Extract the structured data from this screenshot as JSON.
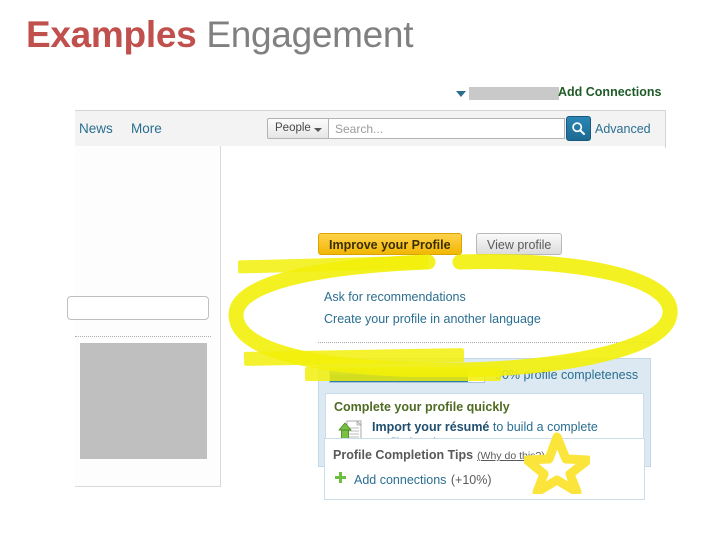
{
  "slide": {
    "title_strong": "Examples",
    "title_normal": " Engagement"
  },
  "screenshot": {
    "topbar": {
      "name_caret_icon": "caret-down-icon",
      "redacted_name": "",
      "add_connections_label": "Add Connections"
    },
    "navbar": {
      "links": [
        {
          "label": "News"
        },
        {
          "label": "More"
        }
      ],
      "search_scope_label": "People",
      "search_scope_caret_icon": "caret-down-icon",
      "search_placeholder": "Search...",
      "search_value": "",
      "search_button_icon": "search-icon",
      "advanced_label": "Advanced"
    },
    "left_panel": {
      "input_value": "",
      "redacted_block": ""
    },
    "profile": {
      "improve_button_label": "Improve your Profile",
      "view_button_label": "View profile",
      "links": [
        {
          "label": "Ask for recommendations"
        },
        {
          "label": "Create your profile in another language"
        }
      ],
      "completeness": {
        "percent": 90,
        "label": "90% profile completeness",
        "quick_heading": "Complete your profile quickly",
        "upload_icon": "upload-document-icon",
        "import_strong": "Import your résumé",
        "import_rest": " to build a complete profile in minutes."
      },
      "tips": {
        "heading": "Profile Completion Tips",
        "why_link": "(Why do this?)",
        "plus_icon": "plus-icon",
        "item_label": "Add connections",
        "item_percent": "(+10%)"
      }
    },
    "annotations": {
      "oval_icon": "marker-oval-annotation",
      "star_icon": "marker-star-annotation",
      "highlighter_icon": "marker-highlight"
    }
  },
  "colors": {
    "title_accent": "#C0504D",
    "title_muted": "#808080",
    "link_blue": "#2A6E91",
    "green": "#1F5C28",
    "marker_yellow": "#F2F009",
    "progress_blue": "#1B6E9E",
    "button_gold": "#F2B705"
  }
}
